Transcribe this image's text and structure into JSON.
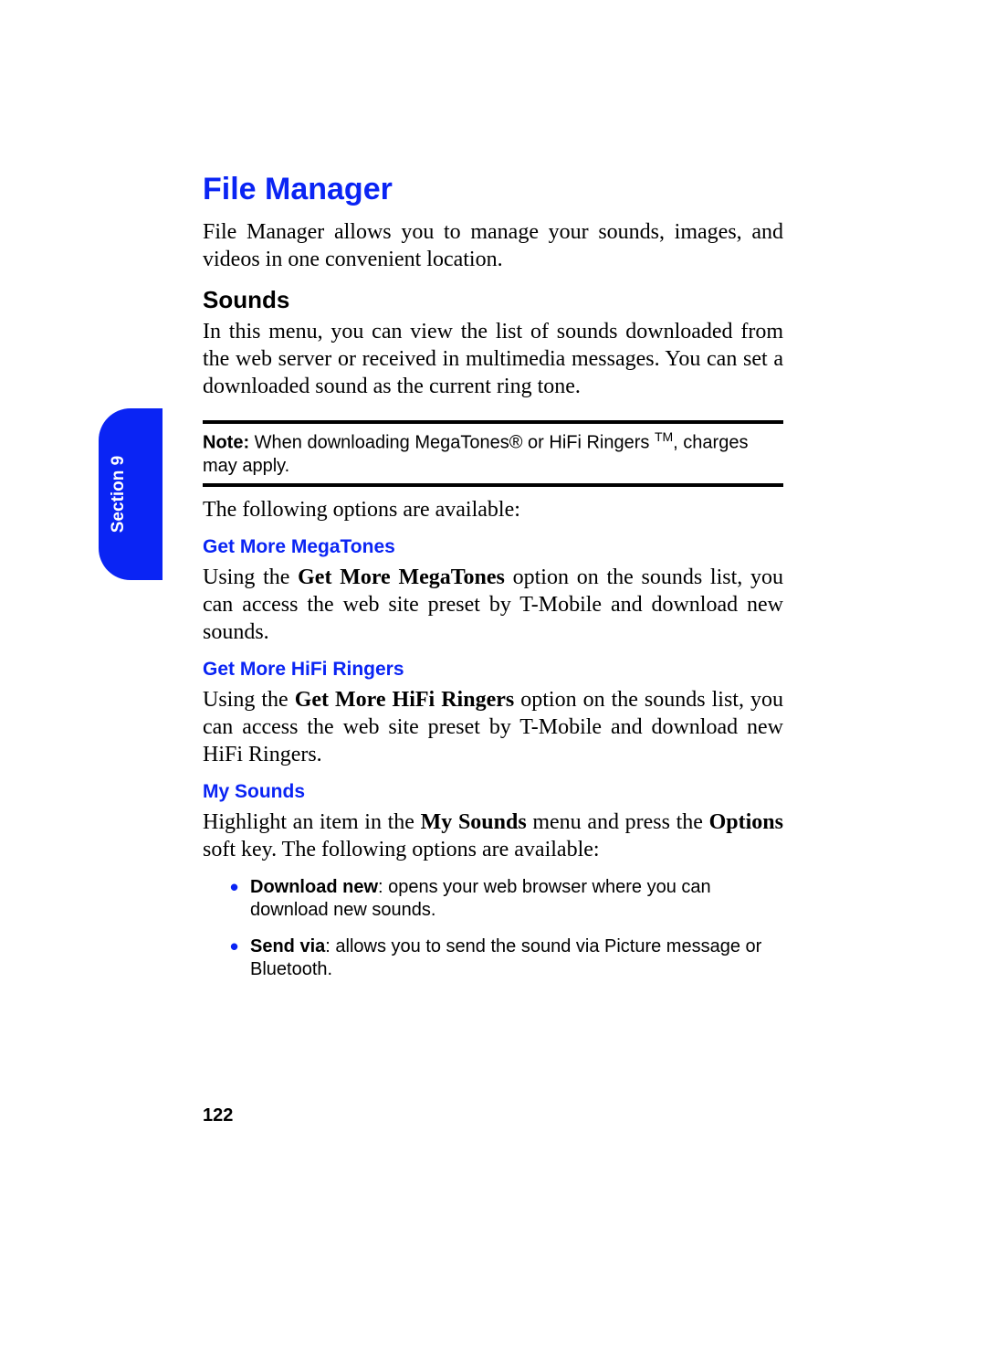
{
  "section_tab": "Section 9",
  "title": "File Manager",
  "intro": "File Manager allows you to manage your sounds, images, and videos in one convenient location.",
  "sounds_heading": "Sounds",
  "sounds_body": "In this menu, you can view the list of sounds downloaded from the web server or received in multimedia messages. You can set a downloaded sound as the current ring tone.",
  "note_label": "Note:",
  "note_body1": " When downloading MegaTones® or HiFi Ringers ",
  "note_tm": "TM",
  "note_body2": ", charges may apply.",
  "options_intro": "The following options are available:",
  "get_more_megatones_heading": "Get More MegaTones",
  "gmm_pre": "Using the ",
  "gmm_bold": "Get More MegaTones",
  "gmm_post": " option on the sounds list, you can access the web site preset by T-Mobile and download new sounds.",
  "get_more_hifi_heading": "Get More HiFi Ringers",
  "gmh_pre": "Using the ",
  "gmh_bold": "Get More HiFi Ringers",
  "gmh_post": " option on the sounds list, you can access the web site preset by T-Mobile and download new HiFi Ringers.",
  "my_sounds_heading": "My Sounds",
  "ms_pre": "Highlight an item in the ",
  "ms_bold1": "My Sounds",
  "ms_mid": " menu and press the ",
  "ms_bold2": "Options",
  "ms_post": " soft key. The following options are available:",
  "bullet1_bold": "Download new",
  "bullet1_rest": ": opens your web browser where you can download new sounds.",
  "bullet2_bold": "Send via",
  "bullet2_rest": ": allows you to send the sound via Picture message or Bluetooth.",
  "page_number": "122"
}
